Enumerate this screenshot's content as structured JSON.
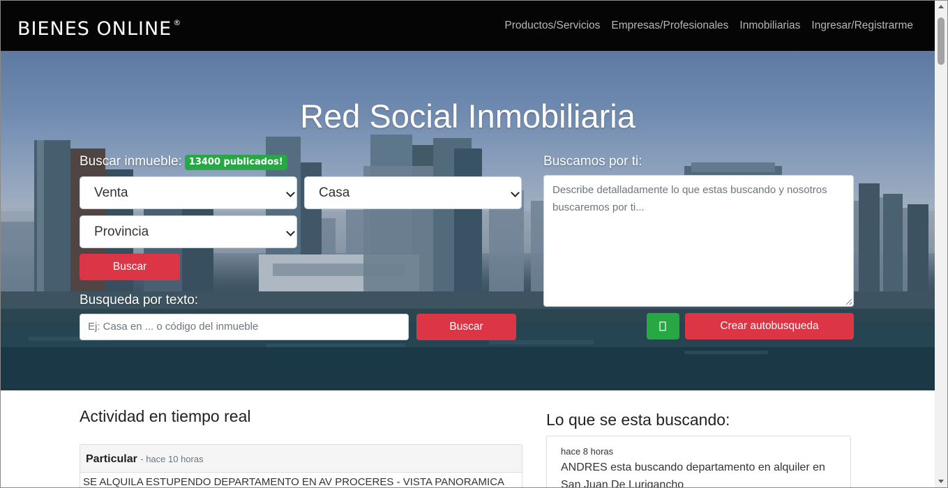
{
  "navbar": {
    "logo": "BIENES ONLINE",
    "logo_mark": "®",
    "links": [
      "Productos/Servicios",
      "Empresas/Profesionales",
      "Inmobiliarias",
      "Ingresar/Registrarme"
    ]
  },
  "hero": {
    "title": "Red Social Inmobiliaria",
    "search_label": "Buscar inmueble:",
    "published_badge": "13400 publicados!",
    "operation_select": "Venta",
    "type_select": "Casa",
    "province_select": "Provincia",
    "search_button": "Buscar",
    "text_search_label": "Busqueda por texto:",
    "text_search_placeholder": "Ej: Casa en ... o código del inmueble",
    "text_search_button": "Buscar",
    "we_search_label": "Buscamos por ti:",
    "we_search_placeholder": "Describe detalladamente lo que estas buscando y nosotros buscaremos por ti...",
    "icon_button_glyph": "",
    "auto_search_button": "Crear autobusqueda"
  },
  "activity": {
    "title": "Actividad en tiempo real",
    "items": [
      {
        "author": "Particular",
        "time": "- hace 10 horas",
        "text": "SE ALQUILA ESTUPENDO DEPARTAMENTO EN AV PROCERES - VISTA PANORAMICA"
      }
    ]
  },
  "searching": {
    "title": "Lo que se esta buscando:",
    "items": [
      {
        "time": "hace 8 horas",
        "text": "ANDRES esta buscando departamento en alquiler en San Juan De Lurigancho"
      }
    ]
  },
  "colors": {
    "navbar": "#050505",
    "accent_red": "#dc3545",
    "badge_green": "#28a745"
  }
}
